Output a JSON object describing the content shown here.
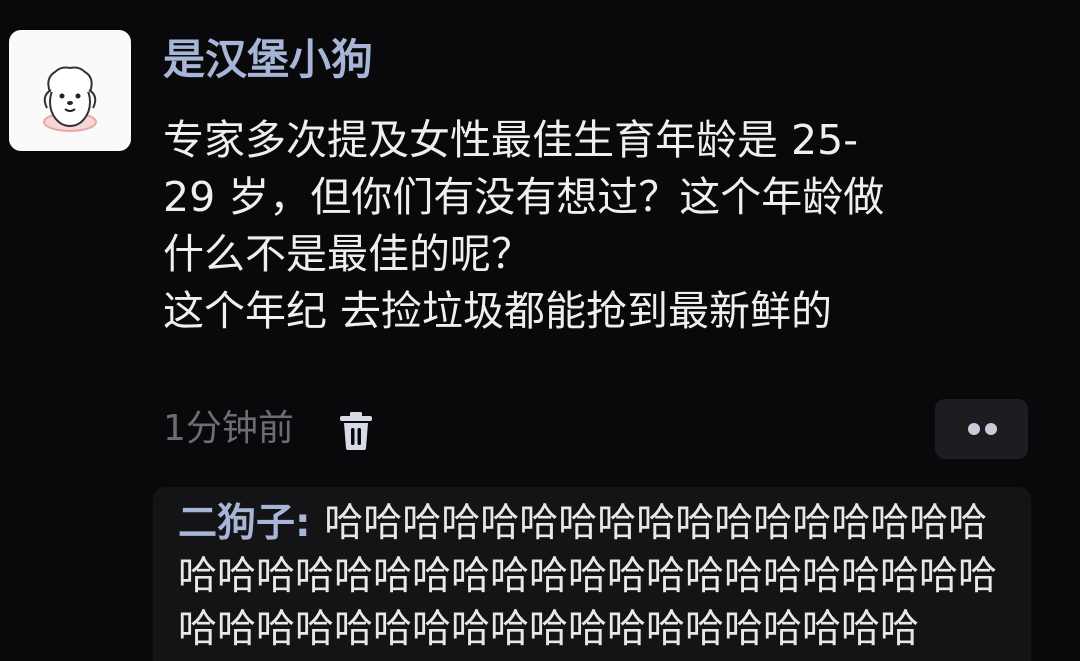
{
  "post": {
    "username": "是汉堡小狗",
    "lines": [
      "专家多次提及女性最佳生育年龄是 25-",
      "29 岁，但你们有没有想过？这个年龄做",
      "什么不是最佳的呢？",
      "这个年纪 去捡垃圾都能抢到最新鲜的"
    ],
    "time": "1分钟前"
  },
  "icons": {
    "delete": "trash-icon",
    "more": "more-dots-icon"
  },
  "reply": {
    "author": "二狗子",
    "separator": ": ",
    "text": "哈哈哈哈哈哈哈哈哈哈哈哈哈哈哈哈哈哈哈哈哈哈哈哈哈哈哈哈哈哈哈哈哈哈哈哈哈哈哈哈哈哈哈哈哈哈哈哈哈哈哈哈哈哈哈哈哈"
  },
  "colors": {
    "background": "#09090b",
    "username": "#a7b6d6",
    "text": "#efefef",
    "meta": "#6c6c72",
    "reply_bg": "#141417"
  }
}
